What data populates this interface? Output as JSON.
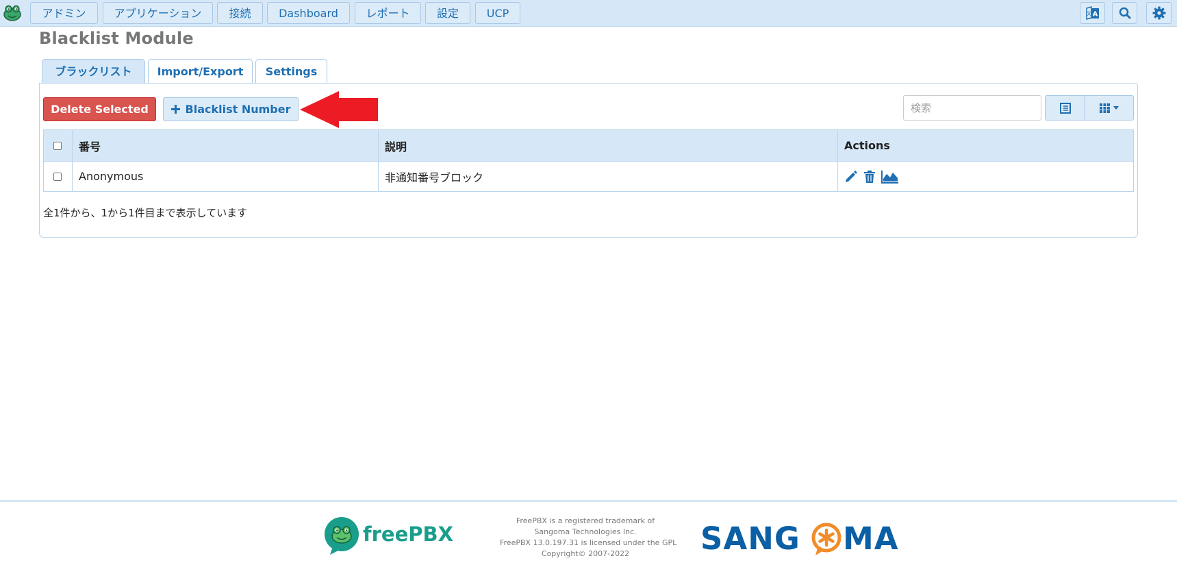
{
  "nav": {
    "items": [
      "アドミン",
      "アプリケーション",
      "接続",
      "Dashboard",
      "レポート",
      "設定",
      "UCP"
    ],
    "icons": [
      "translate-icon",
      "search-icon",
      "gear-icon"
    ]
  },
  "page": {
    "title": "Blacklist Module"
  },
  "tabs": [
    {
      "label": "ブラックリスト",
      "active": true
    },
    {
      "label": "Import/Export",
      "active": false
    },
    {
      "label": "Settings",
      "active": false
    }
  ],
  "toolbar": {
    "delete_label": "Delete Selected",
    "add_label": "Blacklist Number",
    "search_placeholder": "検索"
  },
  "table": {
    "headers": [
      "番号",
      "説明",
      "Actions"
    ],
    "rows": [
      {
        "number": "Anonymous",
        "description": "非通知番号ブロック"
      }
    ],
    "info": "全1件から、1から1件目まで表示しています"
  },
  "footer": {
    "brand": "freePBX",
    "lines": [
      "FreePBX is a registered trademark of",
      "Sangoma Technologies Inc.",
      "FreePBX 13.0.197.31 is licensed under the GPL",
      "Copyright© 2007-2022"
    ],
    "sangoma": "SANGOMA"
  },
  "colors": {
    "accent": "#1f6fb2",
    "nav_bg": "#d6e8f7",
    "danger": "#d9534f",
    "arrow": "#ed1c24",
    "freepbx_green": "#1a9e8c",
    "sangoma_blue": "#0b5fa5",
    "sangoma_orange": "#f28c28"
  }
}
